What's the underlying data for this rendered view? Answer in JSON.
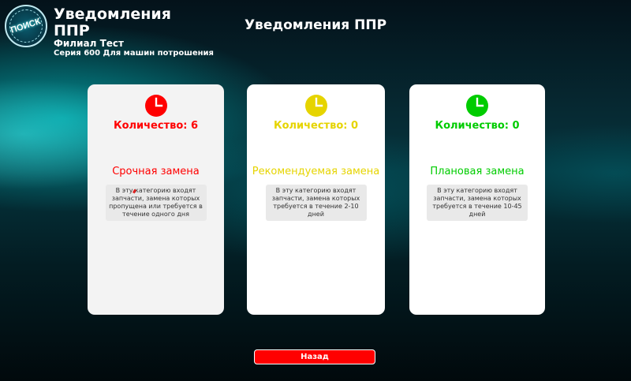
{
  "header": {
    "logo_text": "ПОИСК",
    "app_title": "Уведомления ППР",
    "branch": "Филиал Тест",
    "series": "Серия 600 Для машин потрошения"
  },
  "page_title": "Уведомления ППР",
  "cards": [
    {
      "color": "#ff0000",
      "icon": "clock-icon",
      "count_text": "Количество: 6",
      "count": 6,
      "title": "Срочная замена",
      "description": "В эту категорию входят запчасти, замена которых пропущена или требуется в течение одного дня"
    },
    {
      "color": "#e6d400",
      "icon": "clock-icon",
      "count_text": "Количество: 0",
      "count": 0,
      "title": "Рекомендуемая замена",
      "description": "В эту категорию входят запчасти, замена которых требуется в течение 2-10 дней"
    },
    {
      "color": "#00cc00",
      "icon": "clock-icon",
      "count_text": "Количество: 0",
      "count": 0,
      "title": "Плановая замена",
      "description": "В эту категорию входят запчасти, замена которых требуется в течение 10-45 дней"
    }
  ],
  "back_button": {
    "label": "Назад",
    "color": "#ff0000"
  }
}
